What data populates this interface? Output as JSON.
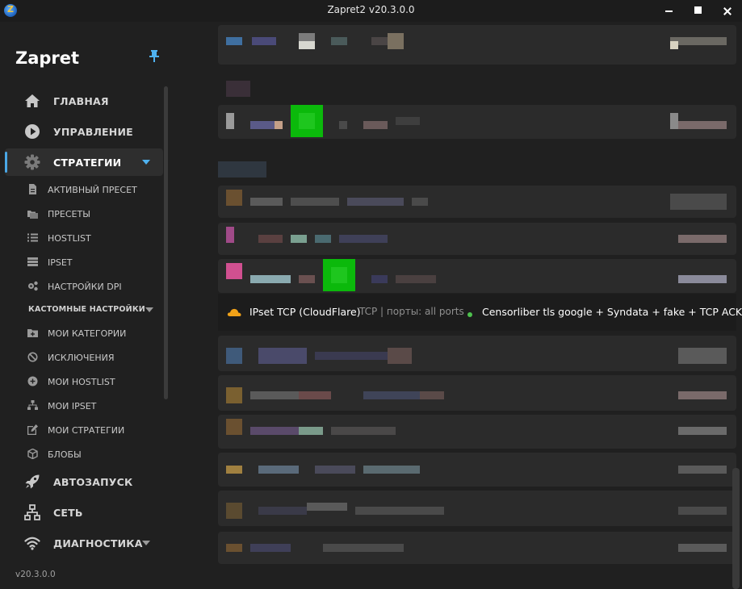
{
  "window": {
    "title": "Zapret2 v20.3.0.0"
  },
  "sidebar": {
    "brand": "Zapret",
    "nav": [
      {
        "label": "ГЛАВНАЯ",
        "icon": "home-icon"
      },
      {
        "label": "УПРАВЛЕНИЕ",
        "icon": "play-icon"
      },
      {
        "label": "СТРАТЕГИИ",
        "icon": "gear-icon",
        "active": true
      },
      {
        "label": "АВТОЗАПУСК",
        "icon": "rocket-icon"
      },
      {
        "label": "СЕТЬ",
        "icon": "network-icon"
      },
      {
        "label": "ДИАГНОСТИКА",
        "icon": "wifi-icon"
      }
    ],
    "strategies_sub": [
      {
        "label": "АКТИВНЫЙ ПРЕСЕТ",
        "icon": "file-icon"
      },
      {
        "label": "ПРЕСЕТЫ",
        "icon": "folders-icon"
      },
      {
        "label": "HOSTLIST",
        "icon": "list-icon"
      },
      {
        "label": "IPSET",
        "icon": "server-icon"
      },
      {
        "label": "НАСТРОЙКИ DPI",
        "icon": "cogs-icon"
      }
    ],
    "custom_header": "КАСТОМНЫЕ НАСТРОЙКИ",
    "custom_sub": [
      {
        "label": "МОИ КАТЕГОРИИ",
        "icon": "folder-plus-icon"
      },
      {
        "label": "ИСКЛЮЧЕНИЯ",
        "icon": "ban-icon"
      },
      {
        "label": "МОИ HOSTLIST",
        "icon": "plus-circle-icon"
      },
      {
        "label": "МОИ IPSET",
        "icon": "sitemap-icon"
      },
      {
        "label": "МОИ СТРАТЕГИИ",
        "icon": "edit-icon"
      },
      {
        "label": "БЛОБЫ",
        "icon": "cube-icon"
      }
    ],
    "version": "v20.3.0.0"
  },
  "active_strategy": {
    "icon": "cloud-icon",
    "name": "IPset TCP (CloudFlare)",
    "meta": "TCP | порты: all ports",
    "value": "Censorliber tls google + Syndata + fake + TCP ACK",
    "status_color": "#4ec24e"
  },
  "colors": {
    "accent": "#4aa7e6",
    "background": "#202020",
    "card": "#2b2b2b"
  }
}
